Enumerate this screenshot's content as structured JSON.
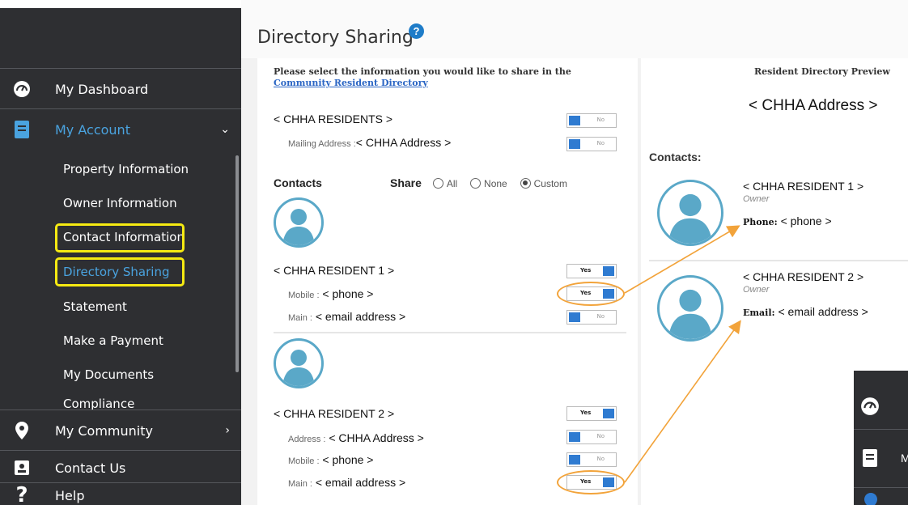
{
  "sidebar": {
    "items": [
      {
        "label": "My Dashboard",
        "icon": "dashboard-icon"
      },
      {
        "label": "My Account",
        "icon": "account-icon"
      },
      {
        "label": "My Community",
        "icon": "location-icon"
      },
      {
        "label": "Contact Us",
        "icon": "contact-card-icon"
      },
      {
        "label": "Help",
        "icon": "question-icon"
      }
    ],
    "sub_items": [
      "Property Information",
      "Owner Information",
      "Contact Information",
      "Directory Sharing",
      "Statement",
      "Make a Payment",
      "My Documents",
      "Compliance"
    ]
  },
  "page": {
    "title": "Directory Sharing"
  },
  "sharing": {
    "intro_text": "Please select the information you would like to share in the ",
    "intro_link": "Community Resident Directory",
    "household": "< CHHA RESIDENTS >",
    "mailing_label": "Mailing Address :",
    "mailing_value": "< CHHA Address >",
    "contacts_header": "Contacts",
    "share_label": "Share",
    "share_options": [
      "All",
      "None",
      "Custom"
    ],
    "share_selected": "Custom",
    "toggle_no": "No",
    "toggle_yes": "Yes",
    "resident1": {
      "name": "< CHHA RESIDENT 1 >",
      "mobile_label": "Mobile :",
      "mobile_value": "< phone >",
      "main_label": "Main :",
      "main_value": "< email address >"
    },
    "resident2": {
      "name": "< CHHA RESIDENT 2 >",
      "address_label": "Address :",
      "address_value": "< CHHA Address >",
      "mobile_label": "Mobile :",
      "mobile_value": "< phone >",
      "main_label": "Main :",
      "main_value": "< email address >"
    }
  },
  "preview": {
    "title": "Resident Directory Preview",
    "address": "< CHHA Address >",
    "contacts_label": "Contacts:",
    "contact1": {
      "name": "< CHHA RESIDENT 1 >",
      "role": "Owner",
      "field_label": "Phone:",
      "field_value": "< phone >"
    },
    "contact2": {
      "name": "< CHHA RESIDENT 2 >",
      "role": "Owner",
      "field_label": "Email:",
      "field_value": "< email address >"
    }
  },
  "colors": {
    "sidebar_bg": "#2e2f32",
    "accent_blue": "#2f7bd1",
    "highlight_yellow": "#f5ea12",
    "callout_orange": "#f2a33a",
    "avatar_ring": "#5aa8c8"
  }
}
